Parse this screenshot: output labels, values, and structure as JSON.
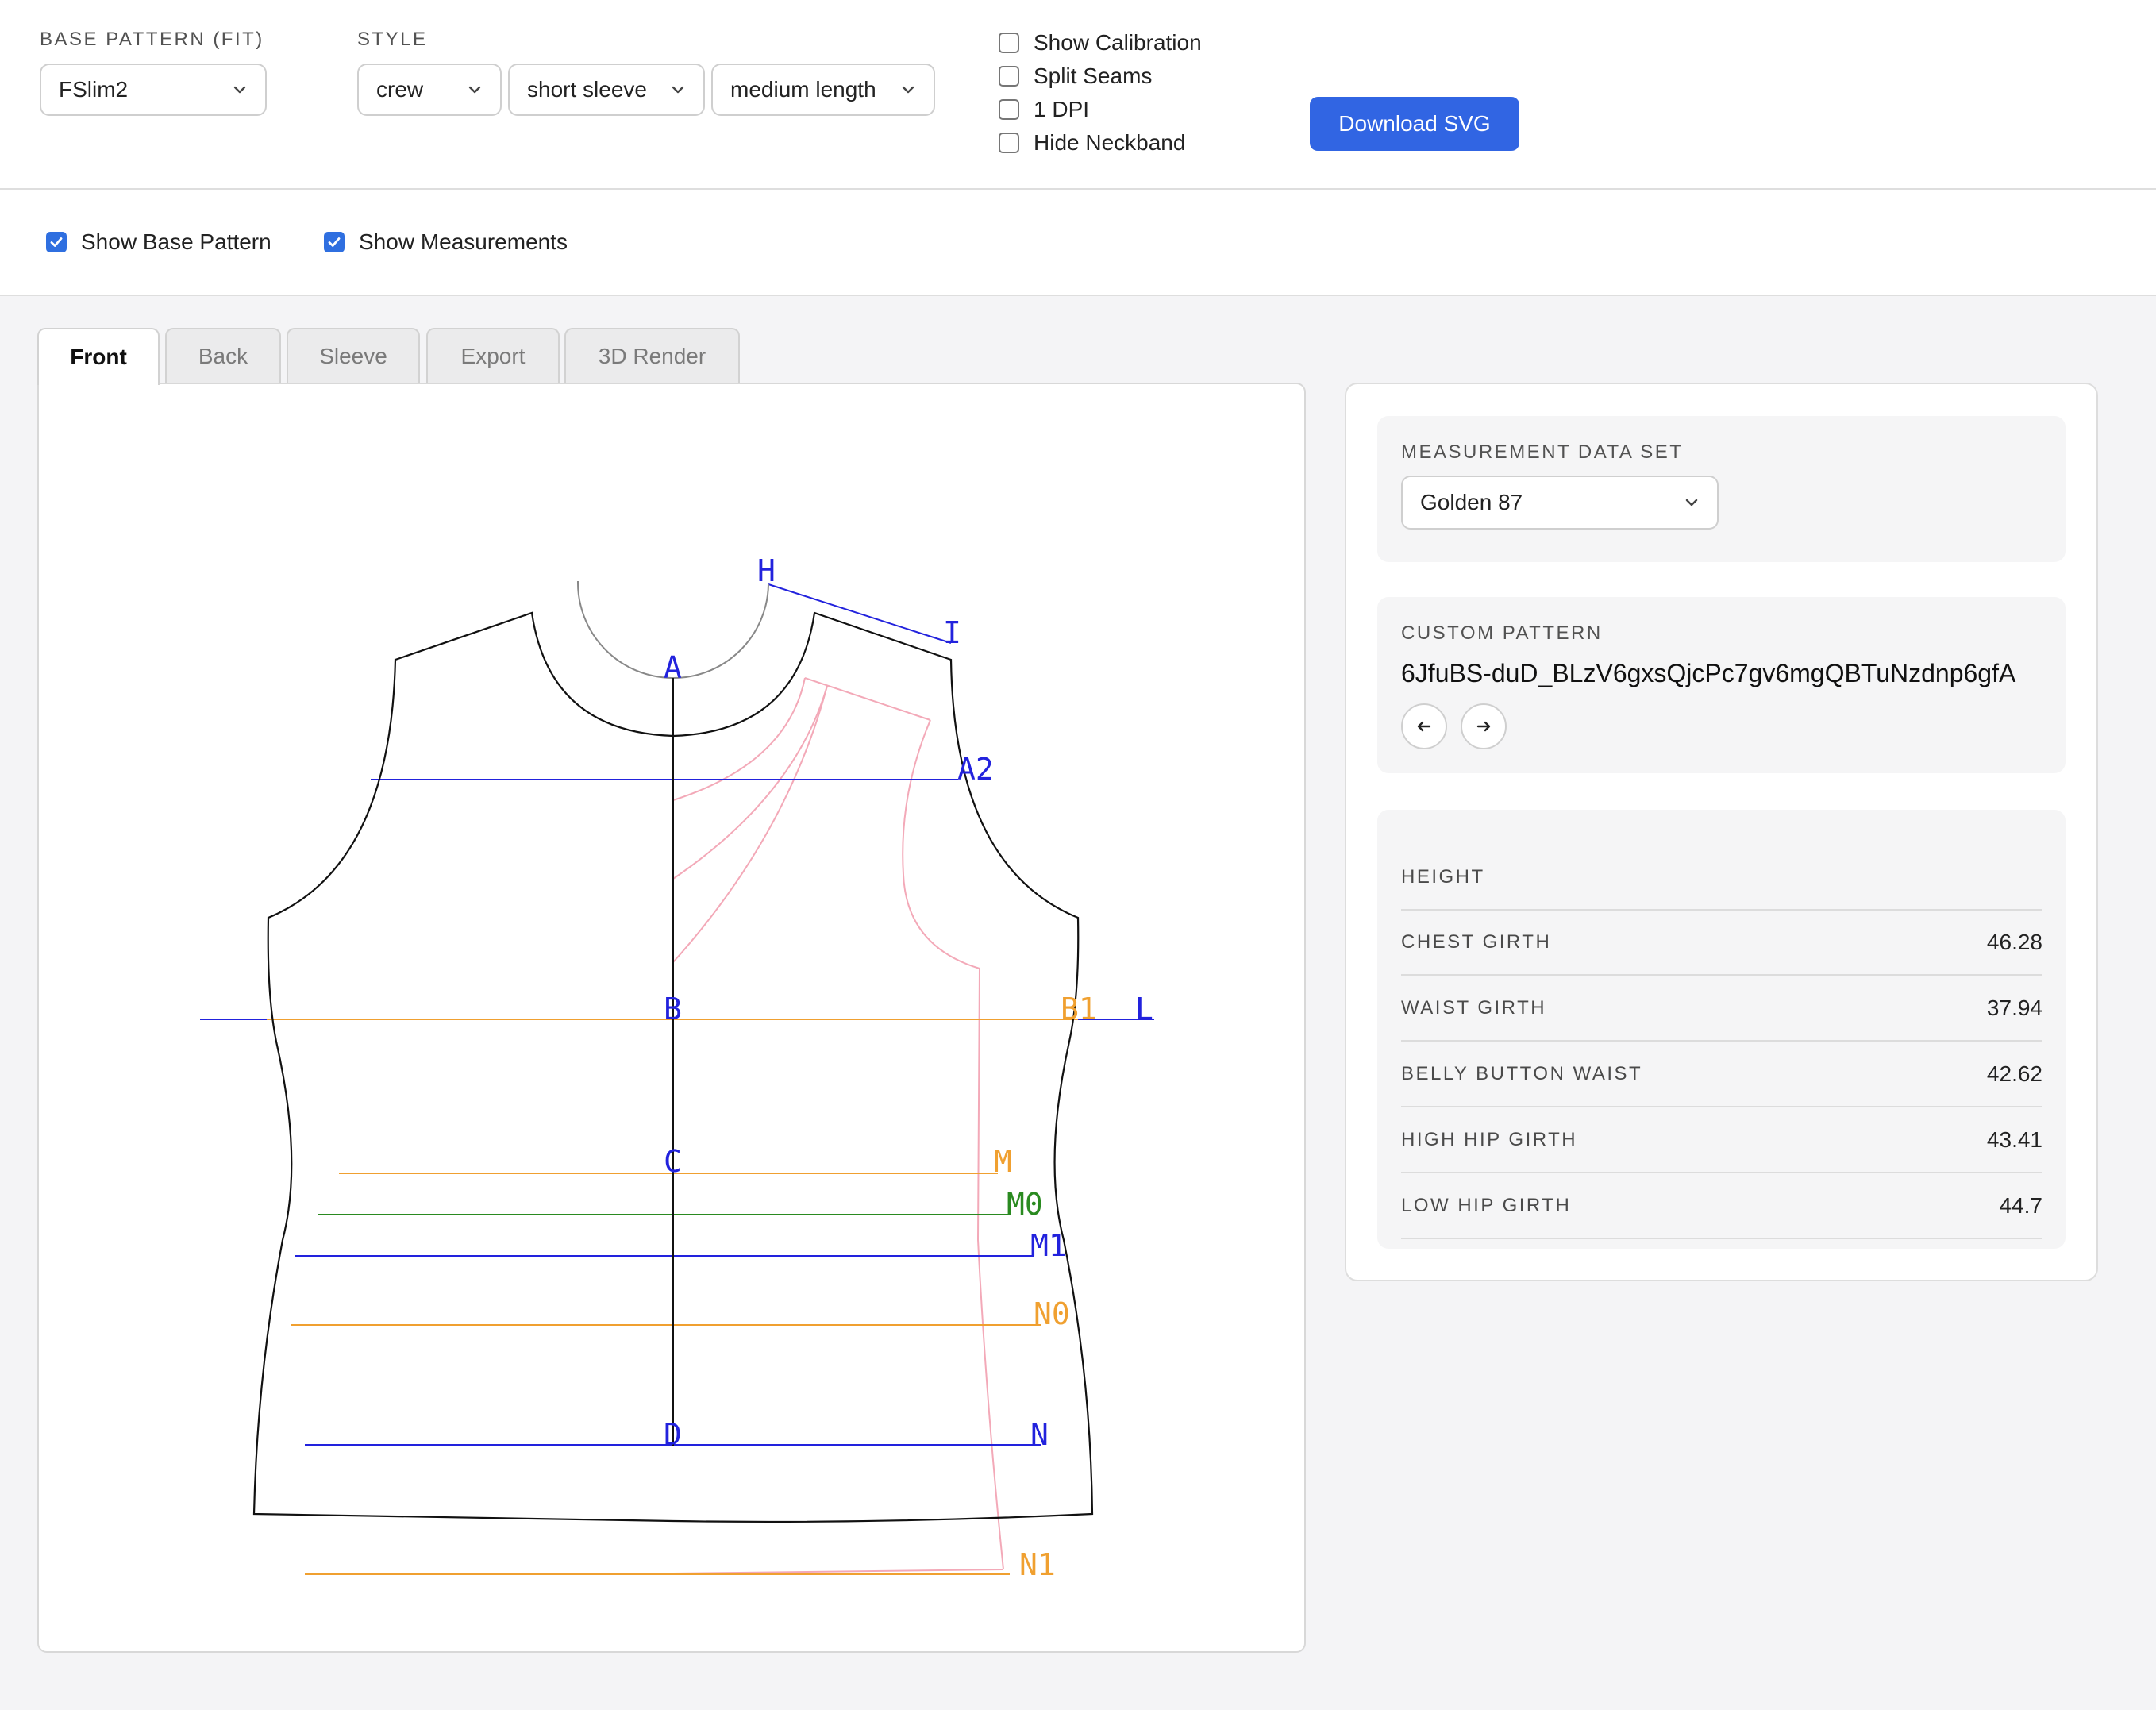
{
  "toolbar": {
    "base_pattern_label": "BASE PATTERN (FIT)",
    "base_pattern_value": "FSlim2",
    "style_label": "STYLE",
    "neck_value": "crew",
    "sleeve_value": "short sleeve",
    "length_value": "medium length",
    "checkboxes": [
      {
        "label": "Show Calibration",
        "checked": false
      },
      {
        "label": "Split Seams",
        "checked": false
      },
      {
        "label": "1 DPI",
        "checked": false
      },
      {
        "label": "Hide Neckband",
        "checked": false
      }
    ],
    "download_label": "Download SVG"
  },
  "options": {
    "show_base_pattern": {
      "label": "Show Base Pattern",
      "checked": true
    },
    "show_measurements": {
      "label": "Show Measurements",
      "checked": true
    }
  },
  "tabs": [
    {
      "label": "Front",
      "active": true
    },
    {
      "label": "Back",
      "active": false
    },
    {
      "label": "Sleeve",
      "active": false
    },
    {
      "label": "Export",
      "active": false
    },
    {
      "label": "3D Render",
      "active": false
    }
  ],
  "pattern_labels": {
    "H": "H",
    "I": "I",
    "A": "A",
    "A2": "A2",
    "B": "B",
    "B1": "B1",
    "L": "L",
    "C": "C",
    "M": "M",
    "M0": "M0",
    "M1": "M1",
    "N0": "N0",
    "D": "D",
    "N": "N",
    "N1": "N1"
  },
  "colors": {
    "blue_line": "#2222dd",
    "orange_line": "#f0a030",
    "green_line": "#2a8a20",
    "pink_base": "#f3a9b8",
    "accent": "#3165e3"
  },
  "side": {
    "dataset_title": "MEASUREMENT DATA SET",
    "dataset_value": "Golden 87",
    "custom_title": "CUSTOM PATTERN",
    "custom_code": "6JfuBS-duD_BLzV6gxsQjcPc7gv6mgQBTuNzdnp6gfA",
    "prev_icon": "arrow-left-icon",
    "next_icon": "arrow-right-icon",
    "measurements": [
      {
        "name": "HEIGHT",
        "value": ""
      },
      {
        "name": "CHEST GIRTH",
        "value": "46.28"
      },
      {
        "name": "WAIST GIRTH",
        "value": "37.94"
      },
      {
        "name": "BELLY BUTTON WAIST",
        "value": "42.62"
      },
      {
        "name": "HIGH HIP GIRTH",
        "value": "43.41"
      },
      {
        "name": "LOW HIP GIRTH",
        "value": "44.7"
      }
    ]
  }
}
